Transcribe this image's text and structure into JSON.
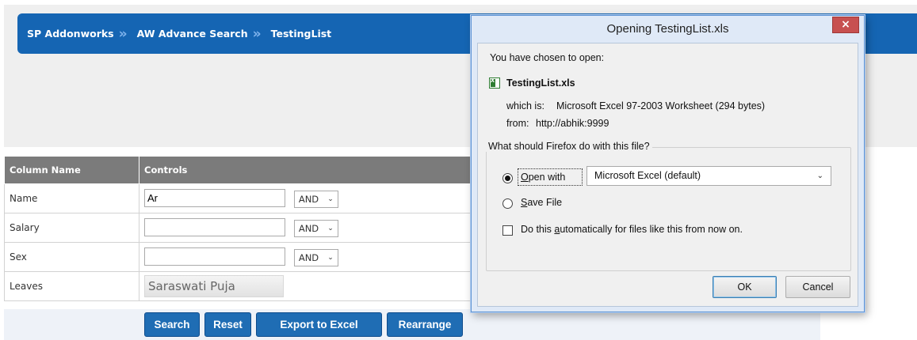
{
  "breadcrumb": {
    "items": [
      "SP Addonworks",
      "AW Advance Search",
      "TestingList"
    ],
    "separator": "»"
  },
  "grid": {
    "headers": [
      "Column Name",
      "Controls"
    ],
    "rows": [
      {
        "name": "Name",
        "value": "Ar",
        "operator": "AND"
      },
      {
        "name": "Salary",
        "value": "",
        "operator": "AND"
      },
      {
        "name": "Sex",
        "value": "",
        "operator": "AND"
      },
      {
        "name": "Leaves",
        "value": "Saraswati Puja"
      }
    ]
  },
  "buttons": {
    "search": "Search",
    "reset": "Reset",
    "export": "Export to Excel",
    "rearrange": "Rearrange"
  },
  "dialog": {
    "title": "Opening TestingList.xls",
    "close_glyph": "×",
    "intro": "You have chosen to open:",
    "file_name": "TestingList.xls",
    "which_is_label": "which is:",
    "which_is_value": "Microsoft Excel 97-2003 Worksheet (294 bytes)",
    "from_label": "from:",
    "from_value": "http://abhik:9999",
    "question": "What should Firefox do with this file?",
    "open_with_prefix": "",
    "open_with_key": "O",
    "open_with_rest": "pen with",
    "open_with_app": "Microsoft Excel (default)",
    "save_key": "S",
    "save_rest": "ave File",
    "auto_pre": "Do this ",
    "auto_key": "a",
    "auto_rest": "utomatically for files like this from now on.",
    "ok": "OK",
    "cancel": "Cancel"
  },
  "colors": {
    "breadcrumb_bg": "#1565b3",
    "button_bg": "#1f6db4",
    "grid_header_bg": "#7b7b7b",
    "close_btn_bg": "#c75050"
  },
  "icons": {
    "breadcrumb_separator": "double-chevron-right-icon",
    "file_type": "excel-file-icon",
    "dropdown": "chevron-down-icon"
  }
}
